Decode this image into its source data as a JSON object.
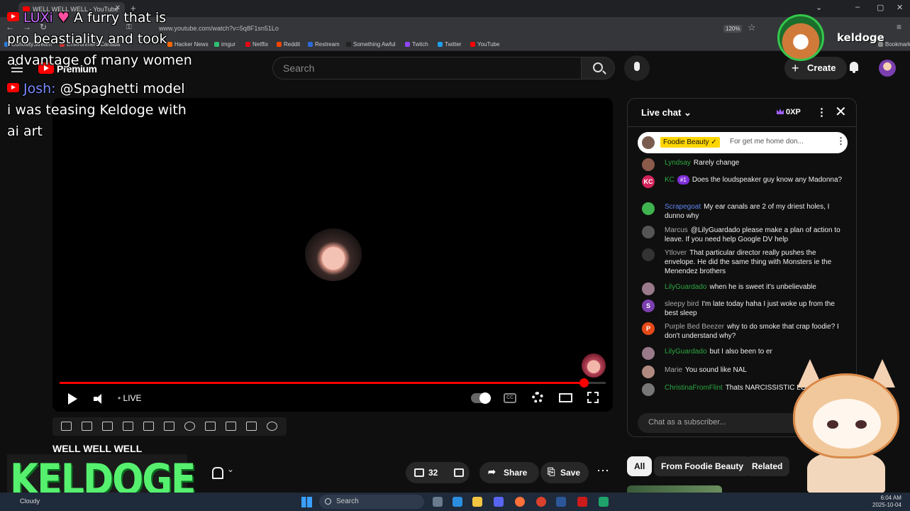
{
  "browser": {
    "tab_title": "WELL WELL WELL - YouTube",
    "url": "www.youtube.com/watch?v=5q8F1sn51Lo",
    "zoom": "120%",
    "bookmarks": [
      "CuriosityStream",
      "Environment Canada",
      "Hacker News",
      "imgur",
      "Netflix",
      "Reddit",
      "Restream",
      "Something Awful",
      "Twitch",
      "Twitter",
      "YouTube"
    ],
    "bookmarks_right": "Bookmarks"
  },
  "masthead": {
    "brand": "Premium",
    "search_placeholder": "Search",
    "create_label": "Create"
  },
  "player": {
    "live_label": "LIVE",
    "progress": 0.96
  },
  "video": {
    "title": "WELL WELL WELL",
    "likes": "32",
    "share_label": "Share",
    "save_label": "Save"
  },
  "chat": {
    "title": "Live chat",
    "xp": "0XP",
    "input_placeholder": "Chat as a subscriber...",
    "pinned": {
      "name": "Foodie Beauty ✓",
      "message": "For get me home don..."
    },
    "messages": [
      {
        "name": "Lyndsay",
        "text": "Rarely change",
        "color": "#2ba640",
        "avatar": "",
        "avatar_bg": "#8a5a4a"
      },
      {
        "name": "KC",
        "badge": "#1",
        "text": "Does the loudspeaker guy know any Madonna?",
        "color": "#2ba640",
        "avatar": "KC",
        "avatar_bg": "#d3235b"
      },
      {
        "name": "Scrapegoat",
        "text": "My ear canals are 2 of my driest holes, I dunno why",
        "color": "#5e84f1",
        "avatar": "",
        "avatar_bg": "#3fb34f"
      },
      {
        "name": "Marcus",
        "text": "@LilyGuardado please make a plan of action to leave. If you need help Google DV help",
        "color": "#aaaaaa",
        "avatar": "",
        "avatar_bg": "#555555"
      },
      {
        "name": "Ytlover",
        "text": "That particular director really pushes the envelope. He did the same thing with Monsters ie the Menendez brothers",
        "color": "#aaaaaa",
        "avatar": "",
        "avatar_bg": "#333333"
      },
      {
        "name": "LilyGuardado",
        "text": "when he is sweet it's unbelievable",
        "color": "#2ba640",
        "avatar": "",
        "avatar_bg": "#9a7a8a"
      },
      {
        "name": "sleepy bird",
        "text": "I'm late today haha I just woke up from the best sleep",
        "color": "#aaaaaa",
        "avatar": "S",
        "avatar_bg": "#7b3fb0"
      },
      {
        "name": "Purple Bed Beezer",
        "text": "why to do smoke that crap foodie? I don't understand why?",
        "color": "#aaaaaa",
        "avatar": "P",
        "avatar_bg": "#e64a19"
      },
      {
        "name": "LilyGuardado",
        "text": "but I also been to er",
        "color": "#2ba640",
        "avatar": "",
        "avatar_bg": "#9a7a8a"
      },
      {
        "name": "Marie",
        "text": "You sound like NAL",
        "color": "#aaaaaa",
        "avatar": "",
        "avatar_bg": "#b08a80"
      },
      {
        "name": "ChristinaFromFlint",
        "text": "Thats NARCISSISTIC LOVE",
        "color": "#2ba640",
        "avatar": "",
        "avatar_bg": "#777777"
      }
    ]
  },
  "chips": [
    "All",
    "From Foodie Beauty",
    "Related"
  ],
  "overlay": {
    "line1_name": "LUXi",
    "line1_text": "A furry that is",
    "line2": "pro beastiality and took",
    "line3": "advantage of many women",
    "line4_name": "Josh:",
    "line4_text": "@Spaghetti model",
    "line5": "i was teasing Keldoge with",
    "line6": "ai art",
    "streamer_big": "KELDOGE",
    "streamer_small": "keldoge"
  },
  "taskbar": {
    "weather": "Cloudy",
    "search": "Search",
    "time": "6:04 AM",
    "date": "2025-10-04"
  }
}
